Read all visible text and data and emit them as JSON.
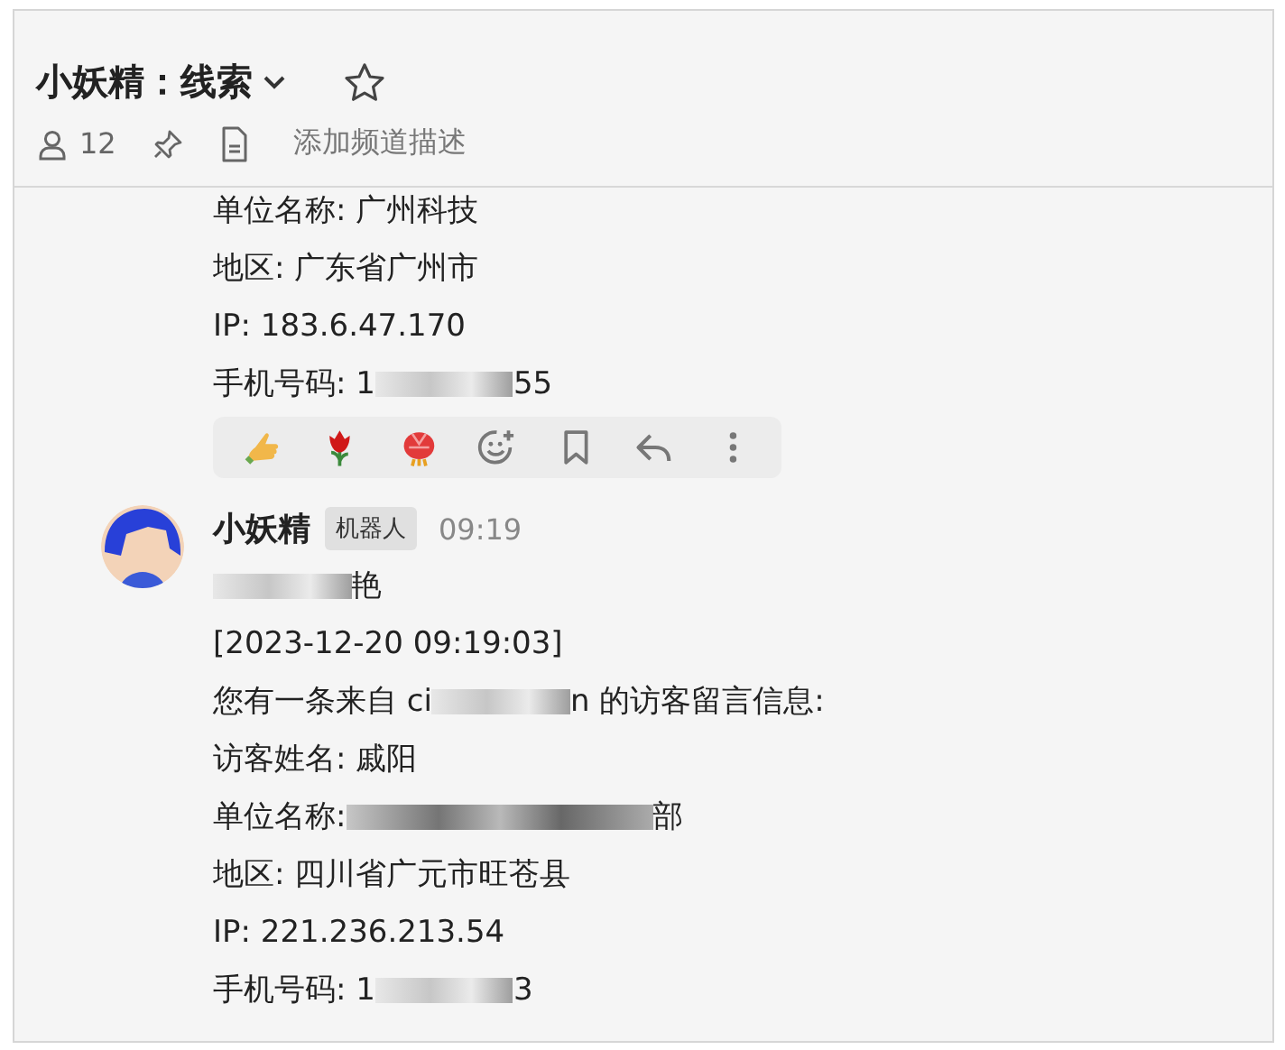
{
  "header": {
    "title": "小妖精：线索",
    "starred": false,
    "member_count": "12",
    "description_placeholder": "添加频道描述"
  },
  "messages": [
    {
      "continued": true,
      "lines": [
        [
          {
            "kind": "text",
            "text": "单位名称: 广州科技"
          }
        ],
        [
          {
            "kind": "text",
            "text": "地区: 广东省广州市"
          }
        ],
        [
          {
            "kind": "text",
            "text": "IP: 183.6.47.170"
          }
        ],
        [
          {
            "kind": "text",
            "text": "手机号码: 1"
          },
          {
            "kind": "redacted"
          },
          {
            "kind": "text",
            "text": "55"
          }
        ]
      ],
      "toolbar": true
    },
    {
      "continued": false,
      "author": "小妖精",
      "badge": "机器人",
      "time": "09:19",
      "lines": [
        [
          {
            "kind": "redacted"
          },
          {
            "kind": "text",
            "text": "艳"
          }
        ],
        [
          {
            "kind": "text",
            "text": "[2023-12-20 09:19:03]"
          }
        ],
        [
          {
            "kind": "text",
            "text": "您有一条来自 ci"
          },
          {
            "kind": "redacted"
          },
          {
            "kind": "text",
            "text": "n 的访客留言信息:"
          }
        ],
        [
          {
            "kind": "text",
            "text": "访客姓名: 戚阳"
          }
        ],
        [
          {
            "kind": "text",
            "text": "单位名称: "
          },
          {
            "kind": "redacted_long"
          },
          {
            "kind": "text",
            "text": "部"
          }
        ],
        [
          {
            "kind": "text",
            "text": "地区: 四川省广元市旺苍县"
          }
        ],
        [
          {
            "kind": "text",
            "text": "IP: 221.236.213.54"
          }
        ],
        [
          {
            "kind": "text",
            "text": "手机号码: 1"
          },
          {
            "kind": "redacted"
          },
          {
            "kind": "text",
            "text": "3"
          }
        ]
      ],
      "toolbar": false
    }
  ]
}
